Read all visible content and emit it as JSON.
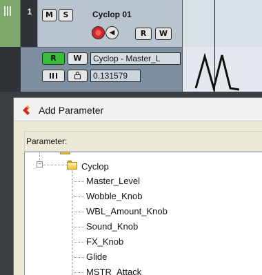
{
  "track": {
    "number": "1",
    "name": "Cyclop 01",
    "mute_label": "M",
    "solo_label": "S",
    "read_label": "R",
    "write_label": "W",
    "monitor_icon": "speaker-icon",
    "record_icon": "record-icon",
    "color": "#7da96c"
  },
  "automation_lane": {
    "read_label": "R",
    "write_label": "W",
    "parameter_name": "Cyclop - Master_L",
    "value": "0.131579",
    "show_icon": "lane-icon",
    "lock_icon": "lock-icon"
  },
  "dialog": {
    "title": "Add Parameter",
    "parameter_label": "Parameter:",
    "folder": "Cyclop",
    "items": [
      "Master_Level",
      "Wobble_Knob",
      "WBL_Amount_Knob",
      "Sound_Knob",
      "FX_Knob",
      "Glide",
      "MSTR_Attack"
    ]
  },
  "colors": {
    "record": "#c9262a",
    "read_active": "#3bbd3c",
    "dialog_icon": "#d0261f"
  }
}
